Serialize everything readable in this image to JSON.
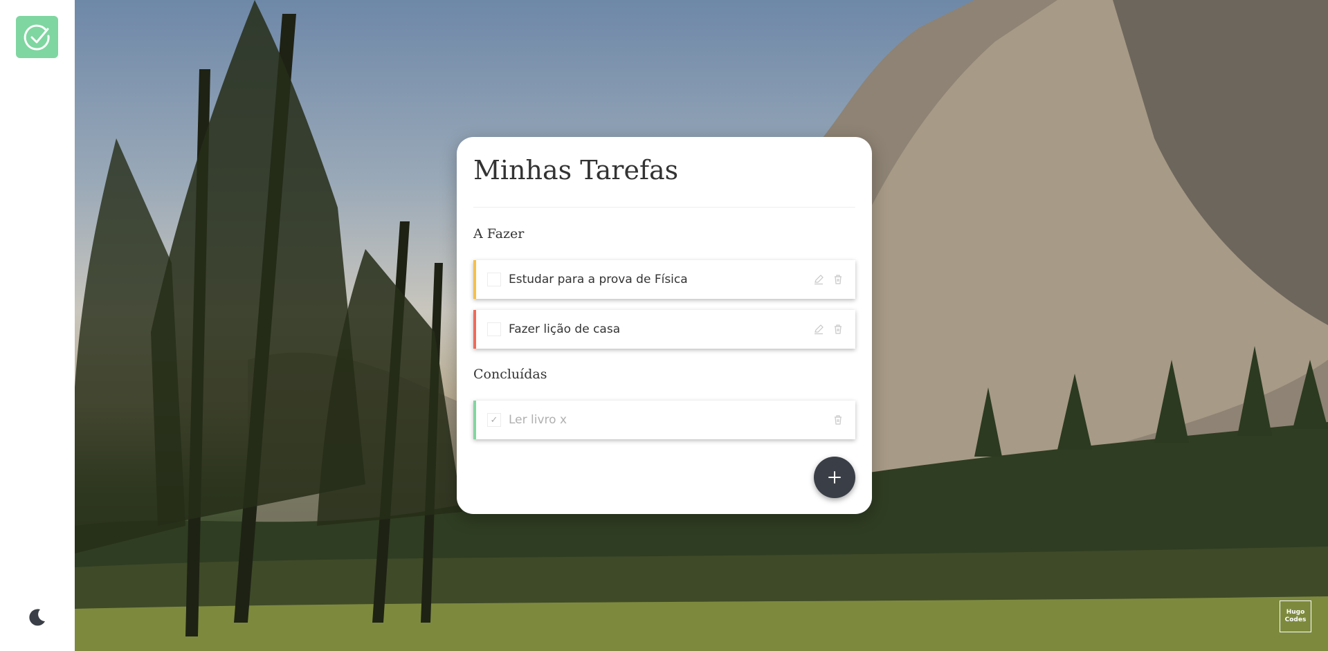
{
  "app": {
    "logo_icon": "check-circle-icon",
    "logo_color": "#7fd6a0"
  },
  "theme_toggle": {
    "icon": "moon-icon"
  },
  "card": {
    "title": "Minhas Tarefas",
    "sections": {
      "todo": {
        "heading": "A Fazer"
      },
      "done": {
        "heading": "Concluídas"
      }
    },
    "tasks": [
      {
        "text": "Estudar para a prova de Física",
        "priority_color": "#f5c04a",
        "completed": false
      },
      {
        "text": "Fazer lição de casa",
        "priority_color": "#f06a5a",
        "completed": false
      },
      {
        "text": "Ler livro x",
        "priority_color": "#82d6a0",
        "completed": true,
        "check_mark": "✓"
      }
    ],
    "add_button": {
      "icon": "plus-icon"
    }
  },
  "watermark": {
    "line1": "Hugo",
    "line2": "Codes"
  }
}
